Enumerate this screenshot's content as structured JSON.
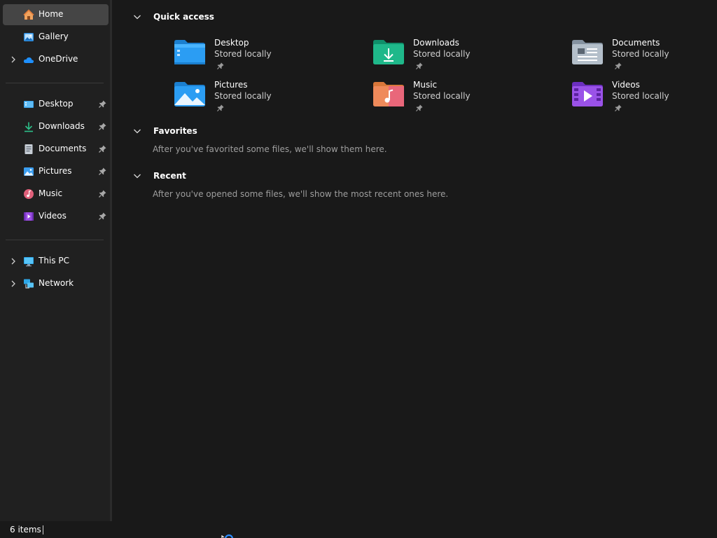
{
  "sidebar": {
    "home": {
      "label": "Home"
    },
    "gallery": {
      "label": "Gallery"
    },
    "onedrive": {
      "label": "OneDrive"
    },
    "pinned": [
      {
        "label": "Desktop",
        "icon": "desktop-icon"
      },
      {
        "label": "Downloads",
        "icon": "downloads-icon"
      },
      {
        "label": "Documents",
        "icon": "documents-icon"
      },
      {
        "label": "Pictures",
        "icon": "pictures-icon"
      },
      {
        "label": "Music",
        "icon": "music-icon"
      },
      {
        "label": "Videos",
        "icon": "videos-icon"
      }
    ],
    "this_pc": {
      "label": "This PC"
    },
    "network": {
      "label": "Network"
    }
  },
  "main": {
    "quick_access": {
      "title": "Quick access",
      "items": [
        {
          "name": "Desktop",
          "subtitle": "Stored locally"
        },
        {
          "name": "Downloads",
          "subtitle": "Stored locally"
        },
        {
          "name": "Documents",
          "subtitle": "Stored locally"
        },
        {
          "name": "Pictures",
          "subtitle": "Stored locally"
        },
        {
          "name": "Music",
          "subtitle": "Stored locally"
        },
        {
          "name": "Videos",
          "subtitle": "Stored locally"
        }
      ]
    },
    "favorites": {
      "title": "Favorites",
      "empty_message": "After you've favorited some files, we'll show them here."
    },
    "recent": {
      "title": "Recent",
      "empty_message": "After you've opened some files, we'll show the most recent ones here."
    }
  },
  "statusbar": {
    "item_count": "6 items"
  },
  "colors": {
    "background": "#191919",
    "sidebar": "#202020",
    "selected": "#454545",
    "muted_text": "#9e9e9e"
  }
}
